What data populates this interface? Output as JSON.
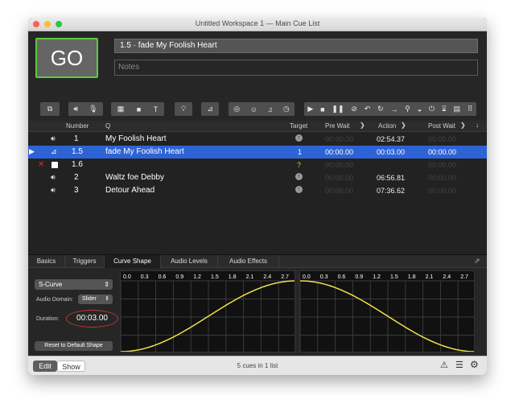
{
  "window": {
    "title": "Untitled Workspace 1 — Main Cue List"
  },
  "go_label": "GO",
  "cue_name_field": "1.5 · fade My Foolish Heart",
  "notes_placeholder": "Notes",
  "table": {
    "headers": {
      "number": "Number",
      "q": "Q",
      "target": "Target",
      "pre_wait": "Pre Wait",
      "action": "Action",
      "post_wait": "Post Wait"
    },
    "rows": [
      {
        "icon": "audio-icon",
        "number": "1",
        "q": "My Foolish Heart",
        "target": "↑",
        "pre_wait": "00:00.00",
        "action": "02:54.37",
        "post_wait": "00:00.00",
        "selected": false
      },
      {
        "icon": "fade-icon",
        "number": "1.5",
        "q": "fade My Foolish Heart",
        "target": "1",
        "pre_wait": "00:00.00",
        "action": "00:03.00",
        "post_wait": "00:00.00",
        "selected": true
      },
      {
        "icon": "stop-icon",
        "number": "1.6",
        "q": "",
        "target": "?",
        "pre_wait": "00:00.00",
        "action": "",
        "post_wait": "00:00.00",
        "selected": false
      },
      {
        "icon": "audio-icon",
        "number": "2",
        "q": "Waltz foe Debby",
        "target": "↑",
        "pre_wait": "00:00.00",
        "action": "06:56.81",
        "post_wait": "00:00.00",
        "selected": false
      },
      {
        "icon": "audio-icon",
        "number": "3",
        "q": "Detour Ahead",
        "target": "↑",
        "pre_wait": "00:00.00",
        "action": "07:36.62",
        "post_wait": "00:00.00",
        "selected": false
      }
    ]
  },
  "tabs": [
    "Basics",
    "Triggers",
    "Curve Shape",
    "Audio Levels",
    "Audio Effects"
  ],
  "active_tab": "Curve Shape",
  "curve": {
    "shape": "S-Curve",
    "audio_domain_label": "Audio Domain:",
    "audio_domain": "Slider",
    "duration_label": "Duration:",
    "duration": "00:03.00",
    "reset_label": "Reset to Default Shape",
    "ticks": [
      "0.0",
      "0.3",
      "0.6",
      "0.9",
      "1.2",
      "1.5",
      "1.8",
      "2.1",
      "2.4",
      "2.7"
    ]
  },
  "status": {
    "edit": "Edit",
    "show": "Show",
    "count": "5 cues in 1 list"
  }
}
